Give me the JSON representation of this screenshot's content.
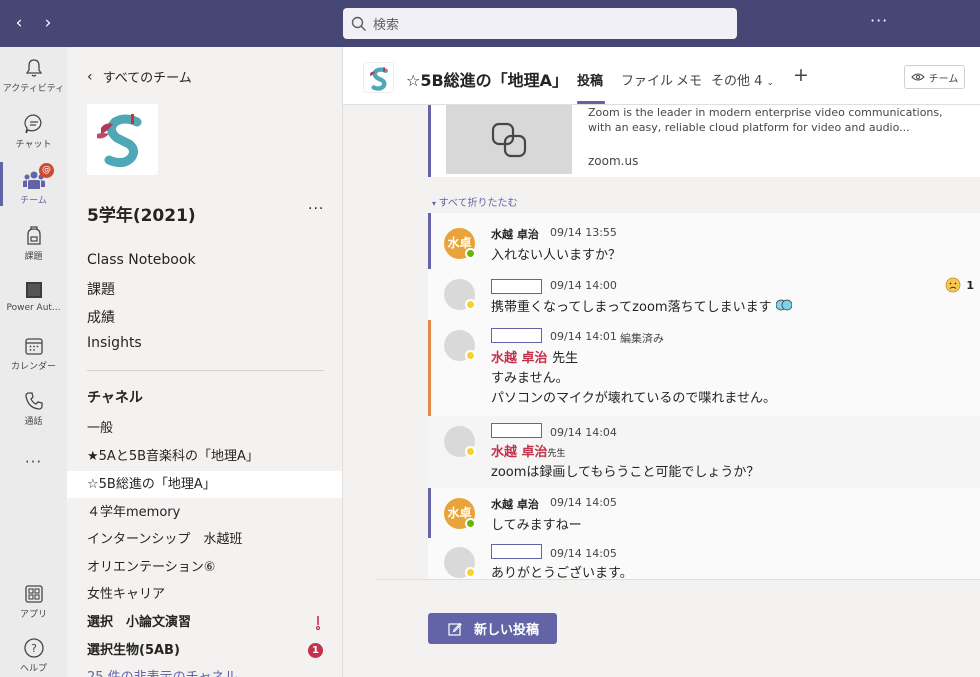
{
  "topbar": {
    "search_placeholder": "検索",
    "more": "···"
  },
  "rail": {
    "activity": "アクティビティ",
    "chat": "チャット",
    "teams": "チーム",
    "teams_badge": "@",
    "assignments": "課題",
    "power_automate": "Power Aut...",
    "calendar": "カレンダー",
    "calls": "通話",
    "more": "···",
    "apps": "アプリ",
    "help": "ヘルプ"
  },
  "team_panel": {
    "back": "すべてのチーム",
    "team_name": "5学年(2021)",
    "more": "···",
    "menu": [
      "Class Notebook",
      "課題",
      "成績",
      "Insights"
    ],
    "channels_title": "チャネル",
    "channels": [
      {
        "label": "一般",
        "active": false,
        "bold": false
      },
      {
        "label": "★5Aと5B音楽科の「地理A」",
        "active": false,
        "bold": false
      },
      {
        "label": "☆5B総進の「地理A」",
        "active": true,
        "bold": false
      },
      {
        "label": "４学年memory",
        "active": false,
        "bold": false
      },
      {
        "label": "インターンシップ　水越班",
        "active": false,
        "bold": false
      },
      {
        "label": "オリエンテーション⑥",
        "active": false,
        "bold": false
      },
      {
        "label": "女性キャリア",
        "active": false,
        "bold": false
      },
      {
        "label": "選択　小論文演習",
        "active": false,
        "bold": true,
        "icon": "mention-alert-icon"
      },
      {
        "label": "選択生物(5AB)",
        "active": false,
        "bold": true,
        "badge": "1"
      },
      {
        "label": "25 件の非表示のチャネル",
        "active": false,
        "bold": false
      }
    ]
  },
  "channel_header": {
    "title": "☆5B総進の「地理A」",
    "tabs": [
      "投稿",
      "ファイル",
      "メモ",
      "その他 4"
    ],
    "team_button": "チーム"
  },
  "link_card": {
    "description": "Zoom is the leader in modern enterprise video communications, with an easy, reliable cloud platform for video and audio...",
    "url": "zoom.us"
  },
  "collapse_label": "すべて折りたたむ",
  "replies": [
    {
      "author": "水越 卓治",
      "time": "09/14 13:55",
      "text": "入れない人いますか？",
      "avatar": "水卓"
    },
    {
      "time": "09/14 14:00",
      "text": "携帯重くなってしまってzoom落ちてしまいます",
      "reaction_count": "1"
    },
    {
      "time": "09/14 14:01",
      "edited": "編集済み",
      "mention": "水越 卓治",
      "mention_suffix": "先生",
      "lines": [
        "すみません。",
        "パソコンのマイクが壊れているので喋れません。"
      ]
    },
    {
      "time": "09/14 14:04",
      "mention": "水越 卓治",
      "mention_suffix": "先生",
      "text": "zoomは録画してもらうこと可能でしょうか？"
    },
    {
      "author": "水越 卓治",
      "time": "09/14 14:05",
      "text": "してみますねー",
      "avatar": "水卓"
    },
    {
      "time": "09/14 14:05",
      "text": "ありがとうございます。"
    }
  ],
  "new_post": "新しい投稿",
  "colors": {
    "brand": "#6264a7",
    "topbar": "#464775",
    "reply_bar_orange": "#e3884a",
    "mention": "#c4314b"
  }
}
